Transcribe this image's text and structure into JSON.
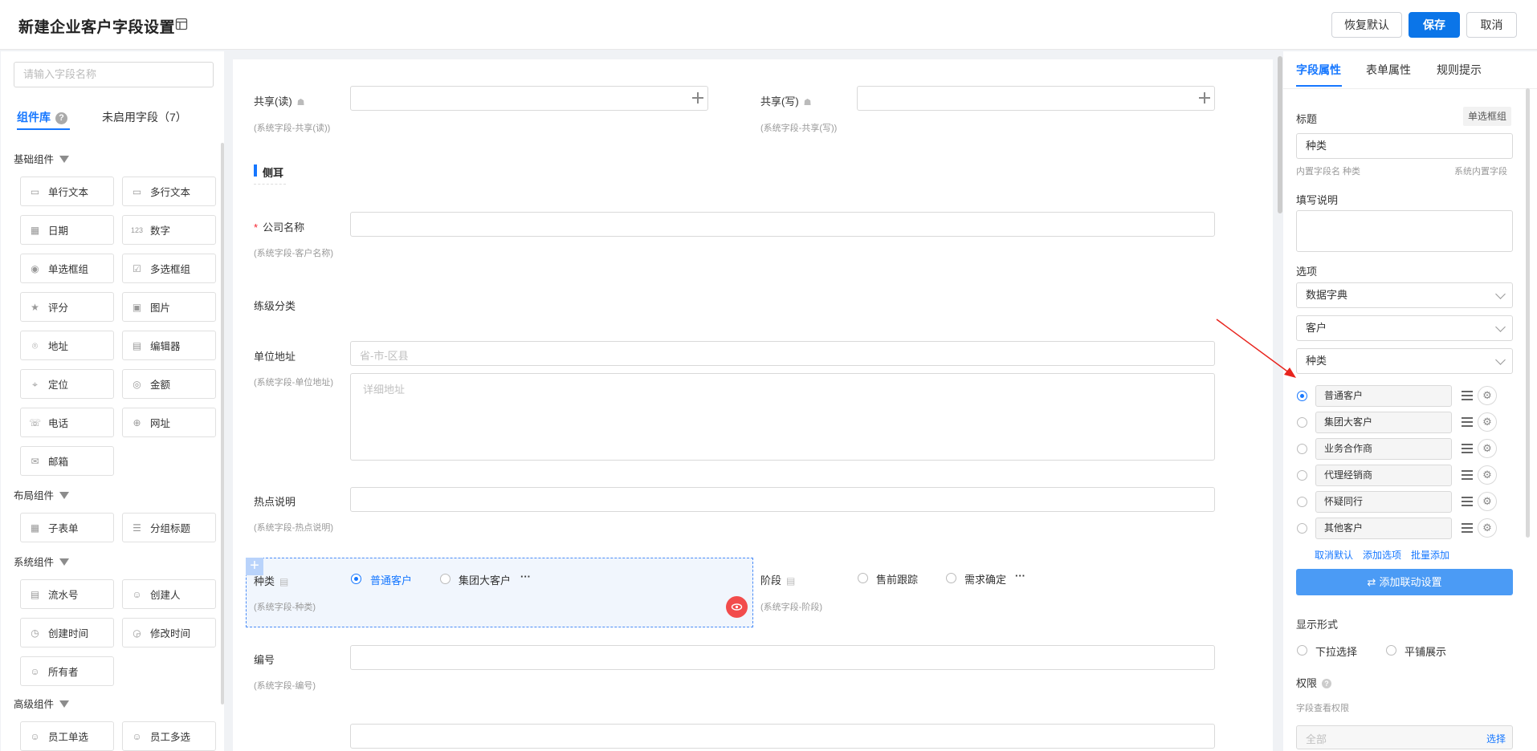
{
  "header": {
    "title": "新建企业客户字段设置",
    "restore_label": "恢复默认",
    "save_label": "保存",
    "cancel_label": "取消"
  },
  "left": {
    "search_placeholder": "请输入字段名称",
    "tabs": [
      "组件库",
      "未启用字段（7）"
    ],
    "groups": {
      "basic": "基础组件",
      "layout": "布局组件",
      "system": "系统组件",
      "advanced": "高级组件"
    },
    "basic_items": [
      "单行文本",
      "多行文本",
      "日期",
      "数字",
      "单选框组",
      "多选框组",
      "评分",
      "图片",
      "地址",
      "编辑器",
      "定位",
      "金额",
      "电话",
      "网址",
      "邮箱"
    ],
    "layout_items": [
      "子表单",
      "分组标题"
    ],
    "system_items": [
      "流水号",
      "创建人",
      "创建时间",
      "修改时间",
      "所有者"
    ],
    "advanced_items": [
      "员工单选",
      "员工多选"
    ]
  },
  "form": {
    "share_read_label": "共享(读)",
    "share_read_sub": "(系统字段-共享(读))",
    "share_write_label": "共享(写)",
    "share_write_sub": "(系统字段-共享(写))",
    "section_title": "侧耳",
    "company_label": "公司名称",
    "company_required": "*",
    "company_sub": "(系统字段-客户名称)",
    "level_label": "练级分类",
    "address_label": "单位地址",
    "address_sub": "(系统字段-单位地址)",
    "address_region_placeholder": "省-市-区县",
    "address_detail_placeholder": "详细地址",
    "hot_label": "热点说明",
    "hot_sub": "(系统字段-热点说明)",
    "type_label": "种类",
    "type_sub": "(系统字段-种类)",
    "type_opt1": "普通客户",
    "type_opt2": "集团大客户",
    "stage_label": "阶段",
    "stage_sub": "(系统字段-阶段)",
    "stage_opt1": "售前跟踪",
    "stage_opt2": "需求确定",
    "more": "···",
    "number_label": "编号",
    "number_sub": "(系统字段-编号)"
  },
  "right": {
    "tabs": [
      "字段属性",
      "表单属性",
      "规则提示"
    ],
    "title_label": "标题",
    "type_tag": "单选框组",
    "title_value": "种类",
    "builtin_name": "内置字段名 种类",
    "builtin_tag": "系统内置字段",
    "fill_label": "填写说明",
    "options_label": "选项",
    "dropdowns": [
      "数据字典",
      "客户",
      "种类"
    ],
    "options": [
      "普通客户",
      "集团大客户",
      "业务合作商",
      "代理经销商",
      "怀疑同行",
      "其他客户"
    ],
    "cancel_default": "取消默认",
    "add_option": "添加选项",
    "batch_add": "批量添加",
    "linkage_button": "添加联动设置",
    "display_label": "显示形式",
    "display_opt1": "下拉选择",
    "display_opt2": "平铺展示",
    "permission_label": "权限",
    "view_permission": "字段查看权限",
    "all_placeholder": "全部",
    "choose": "选择"
  },
  "colors": {
    "accent": "#1677ff",
    "primary_button": "#0b75e8",
    "required": "#f5222d",
    "eye_button": "#f24c4c",
    "arrow": "#e8241d"
  }
}
